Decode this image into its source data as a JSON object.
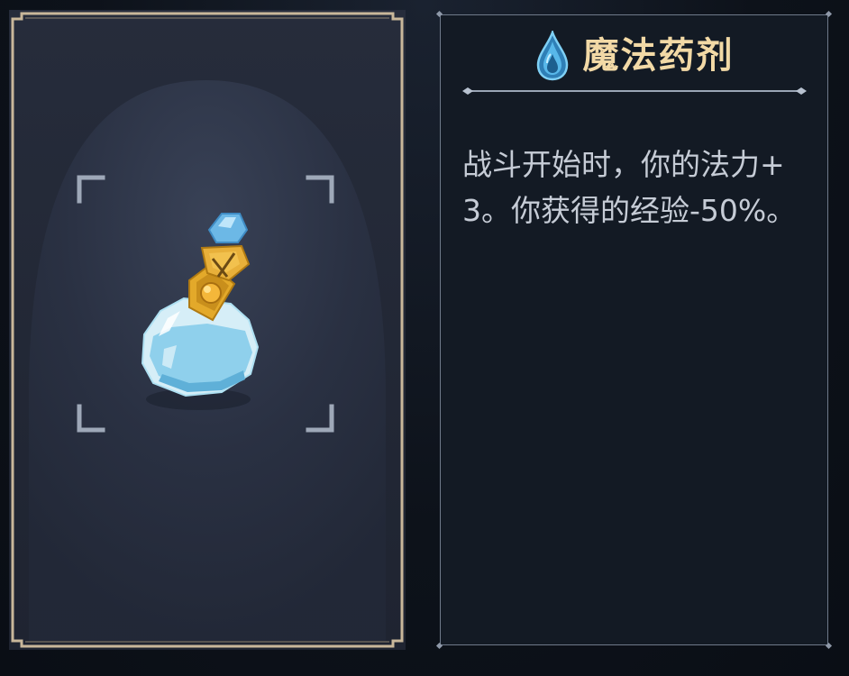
{
  "item": {
    "name": "魔法药剂",
    "description": "战斗开始时，你的法力+3。你获得的经验-50%。",
    "icon": "mana-drop-icon",
    "art": "blue-potion-flask"
  },
  "colors": {
    "title": "#f2d9a6",
    "description": "#c6ccd6",
    "card_border": "#c9b79a",
    "panel_border": "#6f7a8a",
    "potion_liquid": "#8fd0ec",
    "potion_stopper": "#e3a92a",
    "mana_icon": "#58b8ea"
  }
}
